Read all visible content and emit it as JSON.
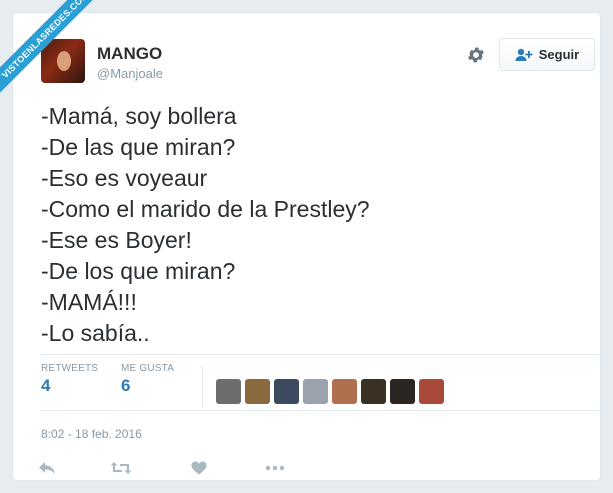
{
  "watermark": "VISTOENLASREDES.COM",
  "user": {
    "display_name": "MANGO",
    "handle": "@Manjoale"
  },
  "follow_button": {
    "label": "Seguir"
  },
  "tweet": {
    "lines": [
      "-Mamá, soy bollera",
      "-De las que miran?",
      "-Eso es voyeaur",
      "-Como el marido de la Prestley?",
      "-Ese es Boyer!",
      "-De los que miran?",
      "-MAMÁ!!!",
      "-Lo sabía.."
    ]
  },
  "stats": {
    "retweets_label": "RETWEETS",
    "retweets_value": "4",
    "likes_label": "ME GUSTA",
    "likes_value": "6"
  },
  "liker_avatar_colors": [
    "#6d6d6d",
    "#8a6a3f",
    "#3b4a5f",
    "#9aa3ad",
    "#b07050",
    "#3a3024",
    "#2c2622",
    "#a84a3a"
  ],
  "timestamp": "8:02 - 18 feb. 2016",
  "colors": {
    "accent": "#2b7bb9",
    "muted": "#8899a6",
    "text": "#292f33",
    "ribbon": "#2a9fd6"
  },
  "icons": [
    "gear-icon",
    "follow-user-icon",
    "reply-icon",
    "retweet-icon",
    "like-icon",
    "more-icon"
  ]
}
